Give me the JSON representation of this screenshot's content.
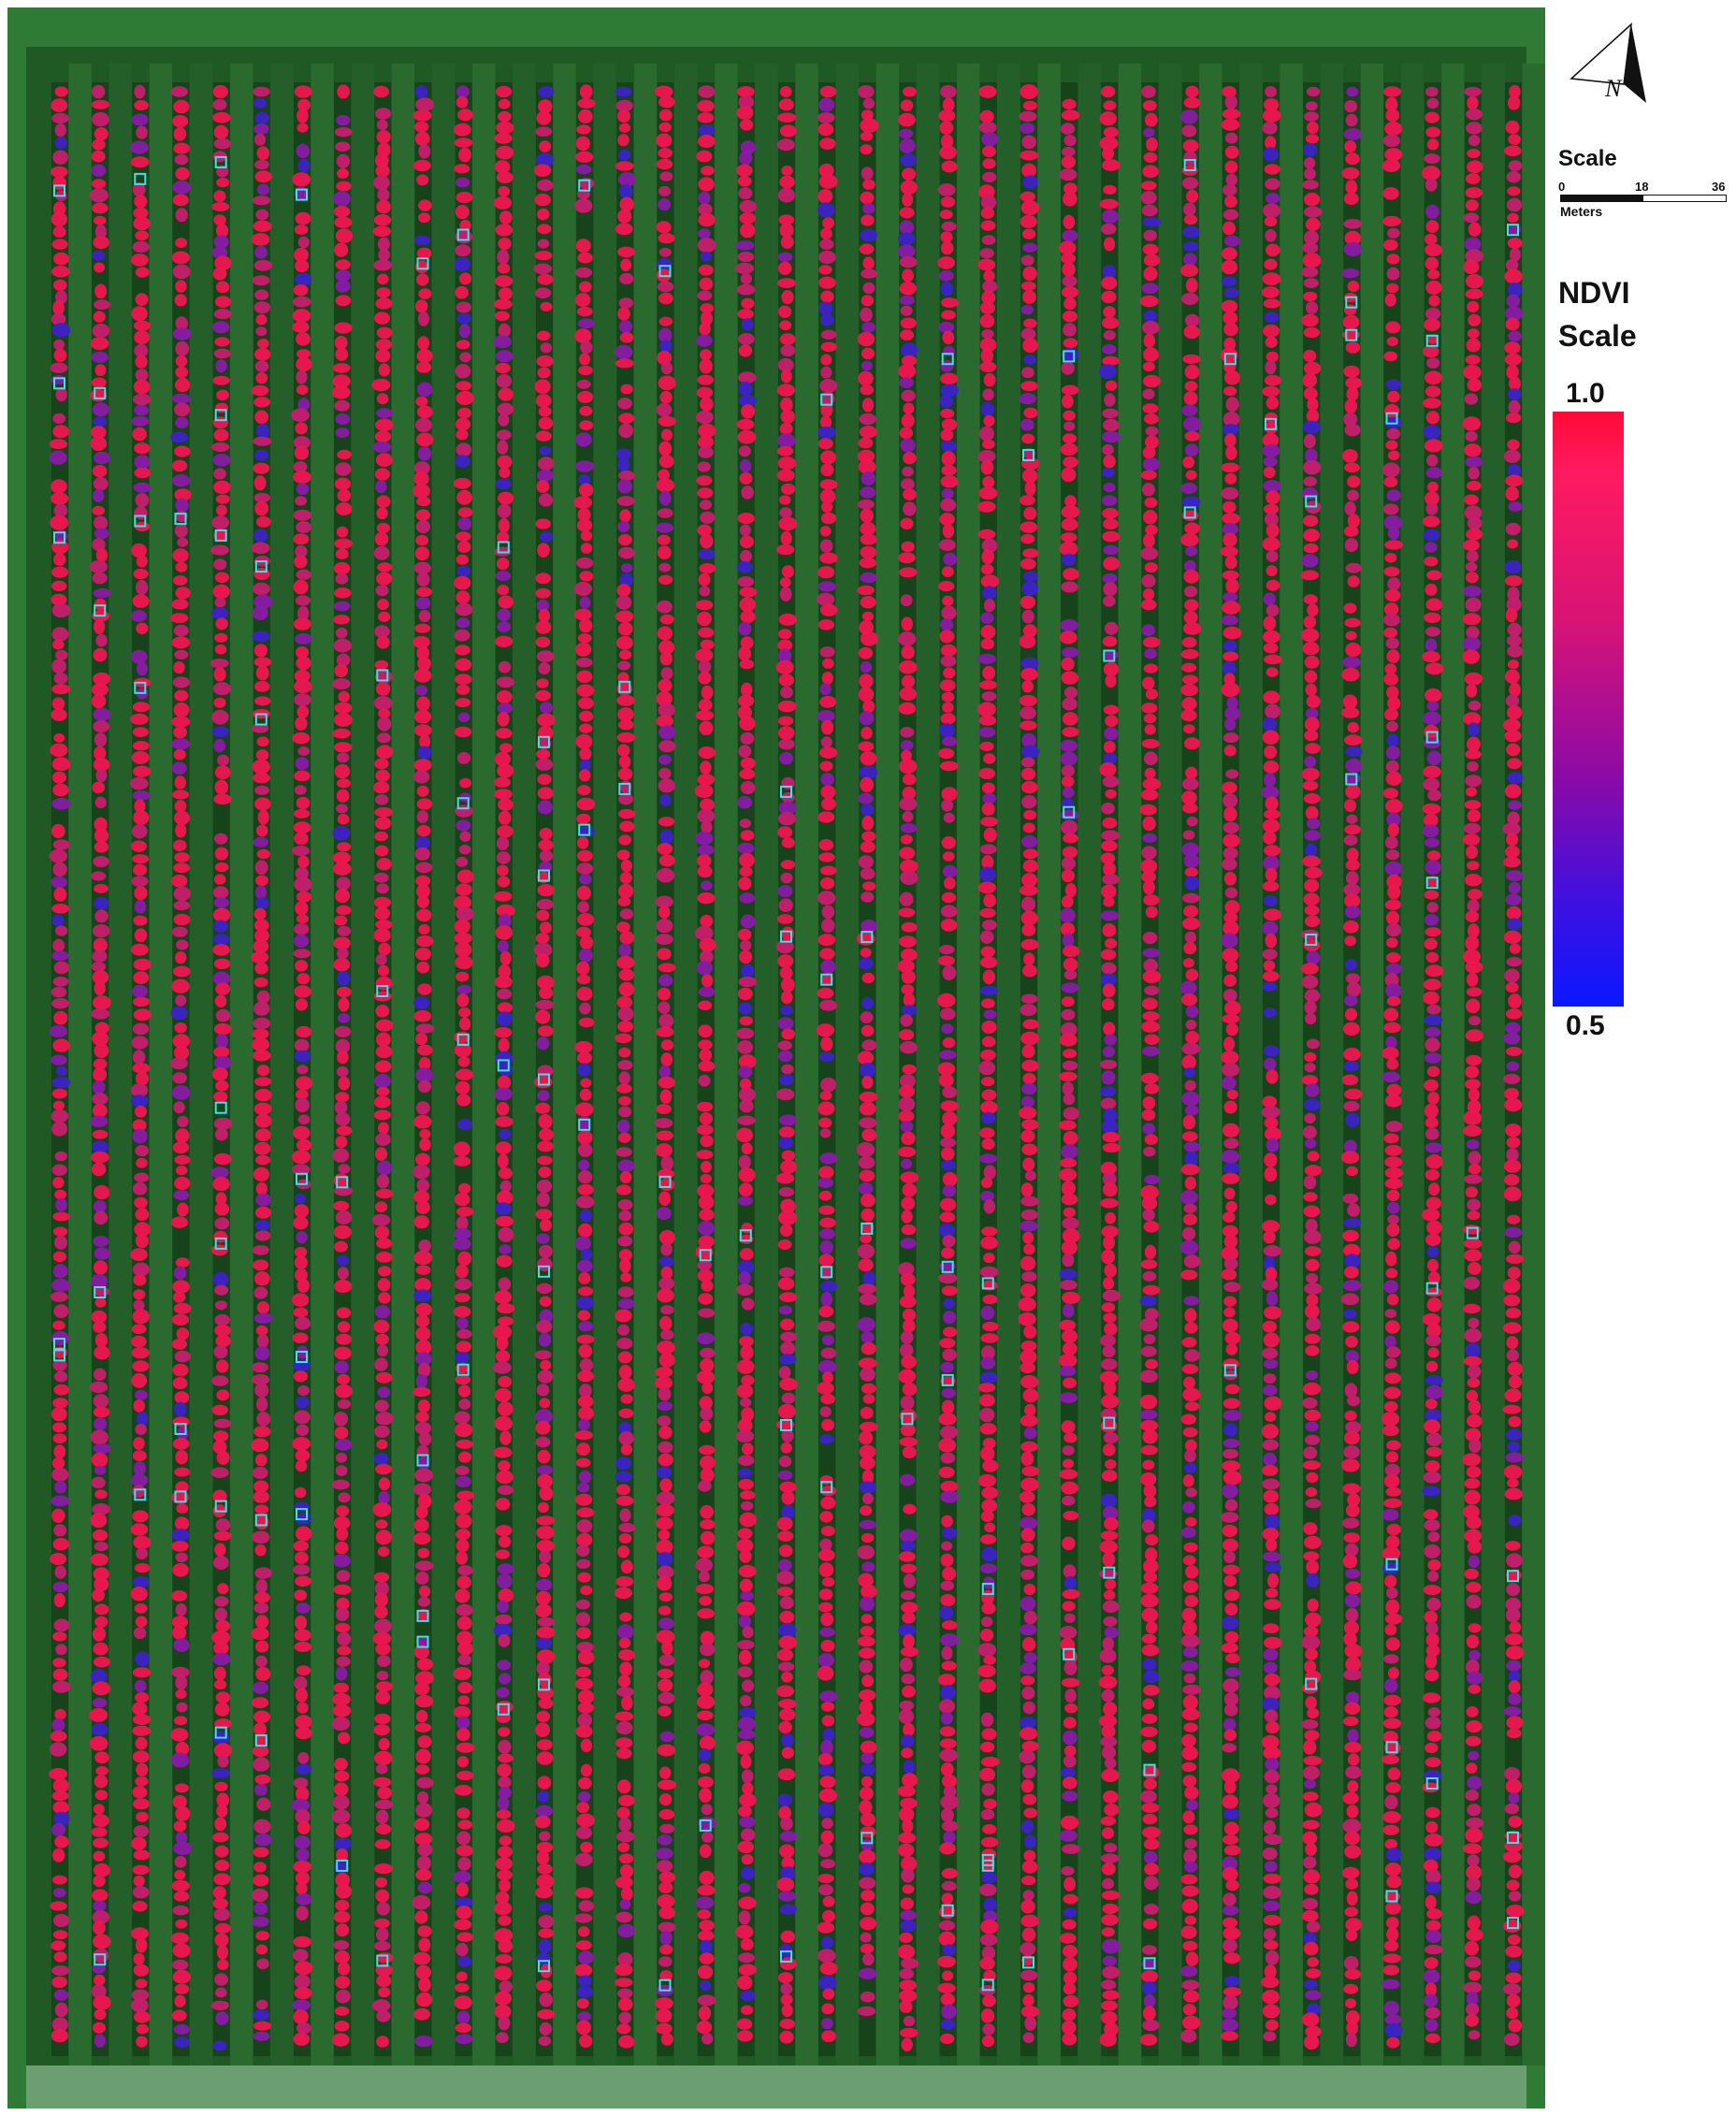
{
  "north_arrow": {
    "letter": "N",
    "icon": "north-arrow-icon"
  },
  "scale_bar": {
    "title": "Scale",
    "ticks": [
      "0",
      "18",
      "36"
    ],
    "units": "Meters"
  },
  "ndvi_legend": {
    "title_line1": "NDVI",
    "title_line2": "Scale",
    "max_label": "1.0",
    "min_label": "0.5",
    "color_high": "#ff0a37",
    "color_low": "#0a18ff"
  },
  "colors": {
    "field_green": "#1f5a25",
    "row_green": "#2f8a34",
    "alley_dark": "#17431b",
    "canopy_high": "#f0154f",
    "canopy_low": "#3d22c8",
    "marker": "#3fe0e6"
  },
  "map": {
    "tree_rows": 37
  }
}
